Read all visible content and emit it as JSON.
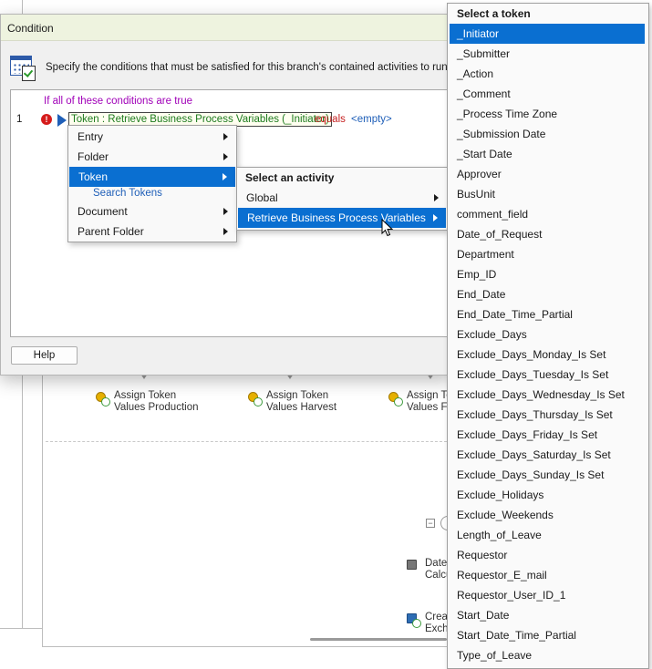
{
  "background": {
    "activities": [
      {
        "label": "Assign Token\nValues Production"
      },
      {
        "label": "Assign Token\nValues Harvest"
      },
      {
        "label": "Assign To\nValues Fa"
      },
      {
        "label": "Date\nCalcu"
      },
      {
        "label": "Creat\nExch"
      }
    ]
  },
  "dialog": {
    "title": "Condition",
    "description": "Specify the conditions that must be satisfied for this branch's contained activities to run.",
    "conditions_header": "If all of these conditions are true",
    "row": {
      "number": "1",
      "error_glyph": "!",
      "token": "Token : Retrieve Business Process Variables (_Initiator)",
      "operator": "equals",
      "value": "<empty>"
    },
    "help_label": "Help"
  },
  "menu_main": {
    "items": [
      {
        "label": "Entry"
      },
      {
        "label": "Folder"
      },
      {
        "label": "Token"
      },
      {
        "label": "Search Tokens"
      },
      {
        "label": "Document"
      },
      {
        "label": "Parent Folder"
      }
    ]
  },
  "menu_activity": {
    "header": "Select an activity",
    "items": [
      {
        "label": "Global"
      },
      {
        "label": "Retrieve Business Process Variables"
      }
    ]
  },
  "menu_token": {
    "header": "Select a token",
    "selected": "_Initiator",
    "items": [
      "_Initiator",
      "_Submitter",
      "_Action",
      "_Comment",
      "_Process Time Zone",
      "_Submission Date",
      "_Start Date",
      "Approver",
      "BusUnit",
      "comment_field",
      "Date_of_Request",
      "Department",
      "Emp_ID",
      "End_Date",
      "End_Date_Time_Partial",
      "Exclude_Days",
      "Exclude_Days_Monday_Is Set",
      "Exclude_Days_Tuesday_Is Set",
      "Exclude_Days_Wednesday_Is Set",
      "Exclude_Days_Thursday_Is Set",
      "Exclude_Days_Friday_Is Set",
      "Exclude_Days_Saturday_Is Set",
      "Exclude_Days_Sunday_Is Set",
      "Exclude_Holidays",
      "Exclude_Weekends",
      "Length_of_Leave",
      "Requestor",
      "Requestor_E_mail",
      "Requestor_User_ID_1",
      "Start_Date",
      "Start_Date_Time_Partial",
      "Type_of_Leave"
    ]
  },
  "colors": {
    "selection": "#0a6fd1",
    "token_text": "#1c7a1c",
    "operator_text": "#c62020",
    "value_text": "#1f5fb8",
    "header_text": "#a000b8"
  }
}
